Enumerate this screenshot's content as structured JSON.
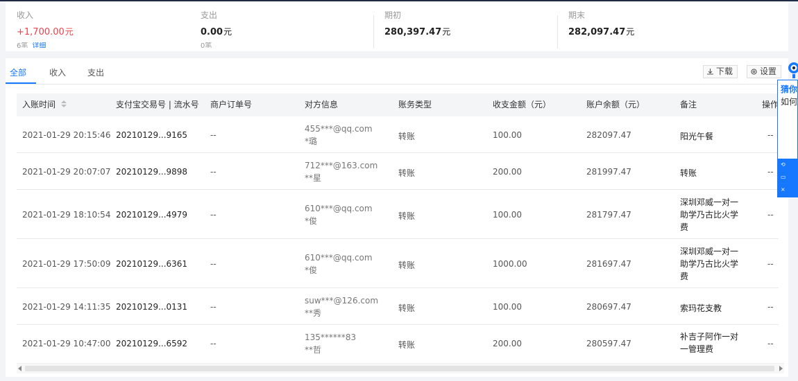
{
  "summary": [
    {
      "label": "收入",
      "value": "+1,700.00",
      "unit": "元",
      "sub_count": "6笔",
      "sub_link": "详细"
    },
    {
      "label": "支出",
      "value": "0.00",
      "unit": "元",
      "sub_count": "0笔",
      "sub_link": ""
    },
    {
      "label": "期初",
      "value": "280,397.47",
      "unit": "元",
      "sub_count": "",
      "sub_link": ""
    },
    {
      "label": "期末",
      "value": "282,097.47",
      "unit": "元",
      "sub_count": "",
      "sub_link": ""
    }
  ],
  "tabs": [
    "全部",
    "收入",
    "支出"
  ],
  "actions": {
    "download": "下载",
    "settings": "设置"
  },
  "table": {
    "headers": [
      "入账时间",
      "支付宝交易号 | 流水号",
      "商户订单号",
      "对方信息",
      "账务类型",
      "收支金额（元）",
      "账户余额（元）",
      "备注",
      "操作"
    ],
    "rows": [
      {
        "time": "2021-01-29 20:15:46",
        "trade_no": "20210129...9165",
        "order_no": "--",
        "cp1": "455***@qq.com",
        "cp2": "*璐",
        "type": "转账",
        "amount": "100.00",
        "balance": "282097.47",
        "remark": "阳光午餐",
        "op": "--"
      },
      {
        "time": "2021-01-29 20:07:07",
        "trade_no": "20210129...9898",
        "order_no": "--",
        "cp1": "712***@163.com",
        "cp2": "**星",
        "type": "转账",
        "amount": "200.00",
        "balance": "281997.47",
        "remark": "转账",
        "op": "--"
      },
      {
        "time": "2021-01-29 18:10:54",
        "trade_no": "20210129...4979",
        "order_no": "--",
        "cp1": "610***@qq.com",
        "cp2": "*俊",
        "type": "转账",
        "amount": "100.00",
        "balance": "281797.47",
        "remark": "深圳邓威一对一助学乃古比火学费",
        "op": "--"
      },
      {
        "time": "2021-01-29 17:50:09",
        "trade_no": "20210129...6361",
        "order_no": "--",
        "cp1": "610***@qq.com",
        "cp2": "*俊",
        "type": "转账",
        "amount": "1000.00",
        "balance": "281697.47",
        "remark": "深圳邓威一对一助学乃古比火学费",
        "op": "--"
      },
      {
        "time": "2021-01-29 14:11:35",
        "trade_no": "20210129...0131",
        "order_no": "--",
        "cp1": "suw***@126.com",
        "cp2": "**秀",
        "type": "转账",
        "amount": "100.00",
        "balance": "280697.47",
        "remark": "索玛花支教",
        "op": "--"
      },
      {
        "time": "2021-01-29 10:47:00",
        "trade_no": "20210129...6592",
        "order_no": "--",
        "cp1": "135******83",
        "cp2": "**哲",
        "type": "转账",
        "amount": "200.00",
        "balance": "280597.47",
        "remark": "补吉子阿作一对一管理费",
        "op": "--"
      }
    ]
  },
  "helper": {
    "title": "猜你问：",
    "body": "如何汇总转账办"
  },
  "colors": {
    "accent": "#1677ff",
    "income": "#e9424b",
    "header_bg": "#f4f5f7"
  }
}
